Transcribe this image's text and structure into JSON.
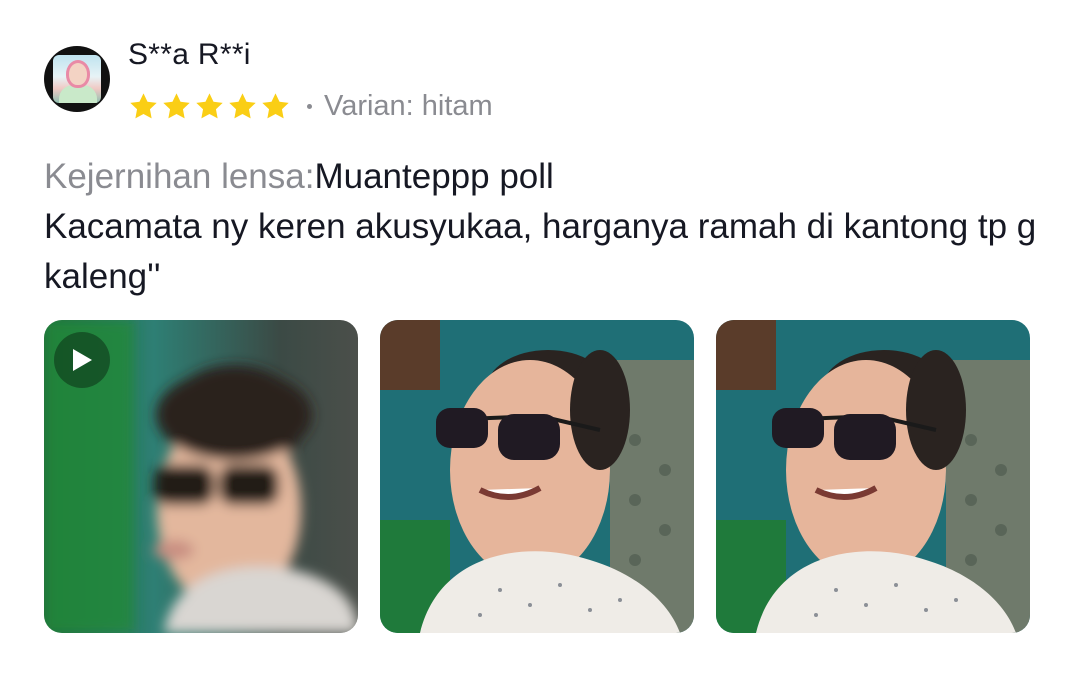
{
  "review": {
    "username": "S**a R**i",
    "rating": 5,
    "variant_text": "Varian: hitam",
    "attribute_label": "Kejernihan lensa:",
    "attribute_value": "Muanteppp poll",
    "body": "Kacamata ny keren akusyukaa, harganya ramah di kantong tp g kaleng''",
    "star_color": "#FACE15",
    "media": [
      {
        "type": "video",
        "icon": "play-icon"
      },
      {
        "type": "photo"
      },
      {
        "type": "photo"
      }
    ]
  }
}
